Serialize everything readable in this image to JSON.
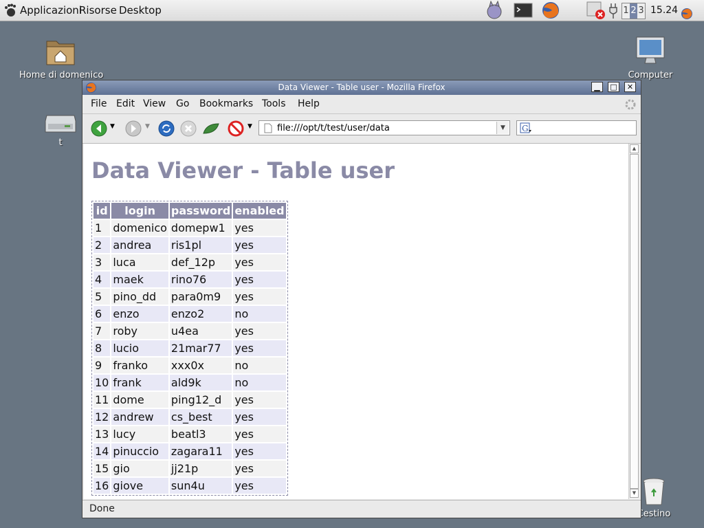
{
  "top_panel": {
    "menus": [
      "Applicazioni",
      "Risorse",
      "Desktop"
    ],
    "workspaces": [
      "1",
      "2",
      "3"
    ],
    "active_workspace": "2",
    "clock": "15.24"
  },
  "desktop": {
    "icons": [
      {
        "label": "Home di domenico",
        "icon": "home-folder-icon"
      },
      {
        "label": "t",
        "icon": "drive-icon"
      },
      {
        "label": "Computer",
        "icon": "computer-icon"
      },
      {
        "label": "Cestino",
        "icon": "trash-icon"
      }
    ]
  },
  "window": {
    "title": "Data Viewer - Table user - Mozilla Firefox",
    "menus": [
      "File",
      "Edit",
      "View",
      "Go",
      "Bookmarks",
      "Tools",
      "Help"
    ],
    "url": "file:///opt/t/test/user/data",
    "search_placeholder": "",
    "status": "Done"
  },
  "page": {
    "title": "Data Viewer - Table user",
    "columns": [
      "id",
      "login",
      "password",
      "enabled"
    ],
    "rows": [
      [
        "1",
        "domenico",
        "domepw1",
        "yes"
      ],
      [
        "2",
        "andrea",
        "ris1pl",
        "yes"
      ],
      [
        "3",
        "luca",
        "def_12p",
        "yes"
      ],
      [
        "4",
        "maek",
        "rino76",
        "yes"
      ],
      [
        "5",
        "pino_dd",
        "para0m9",
        "yes"
      ],
      [
        "6",
        "enzo",
        "enzo2",
        "no"
      ],
      [
        "7",
        "roby",
        "u4ea",
        "yes"
      ],
      [
        "8",
        "lucio",
        "21mar77",
        "yes"
      ],
      [
        "9",
        "franko",
        "xxx0x",
        "no"
      ],
      [
        "10",
        "frank",
        "ald9k",
        "no"
      ],
      [
        "11",
        "dome",
        "ping12_d",
        "yes"
      ],
      [
        "12",
        "andrew",
        "cs_best",
        "yes"
      ],
      [
        "13",
        "lucy",
        "beatl3",
        "yes"
      ],
      [
        "14",
        "pinuccio",
        "zagara11",
        "yes"
      ],
      [
        "15",
        "gio",
        "jj21p",
        "yes"
      ],
      [
        "16",
        "giove",
        "sun4u",
        "yes"
      ]
    ]
  },
  "colors": {
    "desktop_bg": "#687582",
    "title_bar": "#6b7ca0",
    "table_header": "#8a8aa6",
    "row_even": "#e8e8f6",
    "row_odd": "#f2f2f2"
  }
}
